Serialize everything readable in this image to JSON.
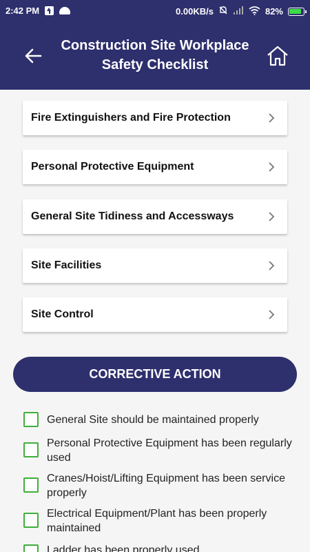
{
  "status_bar": {
    "time": "2:42 PM",
    "network_speed": "0.00KB/s",
    "battery": "82%",
    "icons": [
      "upload-icon",
      "android-icon",
      "mute-bell-icon",
      "signal-icon",
      "wifi-icon",
      "battery-charging-icon"
    ]
  },
  "header": {
    "title_line1": "Construction Site Workplace",
    "title_line2": "Safety Checklist",
    "back_icon": "arrow-left-icon",
    "home_icon": "home-icon"
  },
  "categories": [
    {
      "label": "Fire Extinguishers and Fire Protection"
    },
    {
      "label": "Personal Protective Equipment"
    },
    {
      "label": "General Site Tidiness and Accessways"
    },
    {
      "label": "Site Facilities"
    },
    {
      "label": "Site Control"
    }
  ],
  "corrective_action": {
    "button_label": "CORRECTIVE ACTION"
  },
  "checklist": [
    {
      "label": "General Site should be maintained properly",
      "checked": false
    },
    {
      "label": "Personal Protective Equipment has been regularly used",
      "checked": false
    },
    {
      "label": "Cranes/Hoist/Lifting Equipment has been service properly",
      "checked": false
    },
    {
      "label": "Electrical Equipment/Plant has been properly maintained",
      "checked": false
    },
    {
      "label": "Ladder has been properly used",
      "checked": false
    }
  ],
  "colors": {
    "primary": "#2e2f6d",
    "checkbox_border": "#3fae3a",
    "background": "#f5f5f5"
  }
}
